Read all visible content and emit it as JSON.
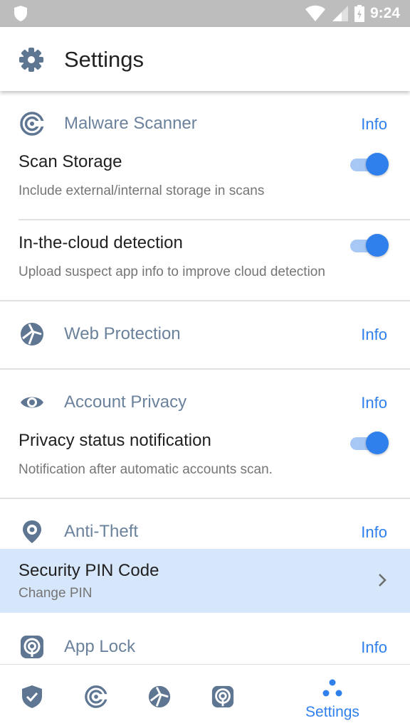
{
  "status_bar": {
    "time": "9:24"
  },
  "app_bar": {
    "title": "Settings",
    "icon": "gear-icon"
  },
  "sections": {
    "malware": {
      "title": "Malware Scanner",
      "info_label": "Info",
      "rows": [
        {
          "title": "Scan Storage",
          "subtitle": "Include external/internal storage in scans",
          "enabled": true
        },
        {
          "title": "In-the-cloud detection",
          "subtitle": "Upload suspect app info to improve cloud detection",
          "enabled": true
        }
      ]
    },
    "web": {
      "title": "Web Protection",
      "info_label": "Info"
    },
    "privacy": {
      "title": "Account Privacy",
      "info_label": "Info",
      "rows": [
        {
          "title": "Privacy status notification",
          "subtitle": "Notification after automatic accounts scan.",
          "enabled": true
        }
      ]
    },
    "antitheft": {
      "title": "Anti-Theft",
      "info_label": "Info",
      "rows": [
        {
          "title": "Security PIN Code",
          "subtitle": "Change PIN"
        }
      ]
    },
    "applock": {
      "title": "App Lock",
      "info_label": "Info"
    }
  },
  "bottom_nav": {
    "items": [
      {
        "icon": "shield-icon"
      },
      {
        "icon": "malware-scanner-icon"
      },
      {
        "icon": "web-protection-icon"
      },
      {
        "icon": "app-lock-icon"
      },
      {
        "icon": "dots-icon",
        "label": "Settings",
        "active": true
      }
    ]
  },
  "colors": {
    "accent": "#2f80ed",
    "section_title": "#6b829c",
    "highlight_row": "#d6e6fb"
  }
}
